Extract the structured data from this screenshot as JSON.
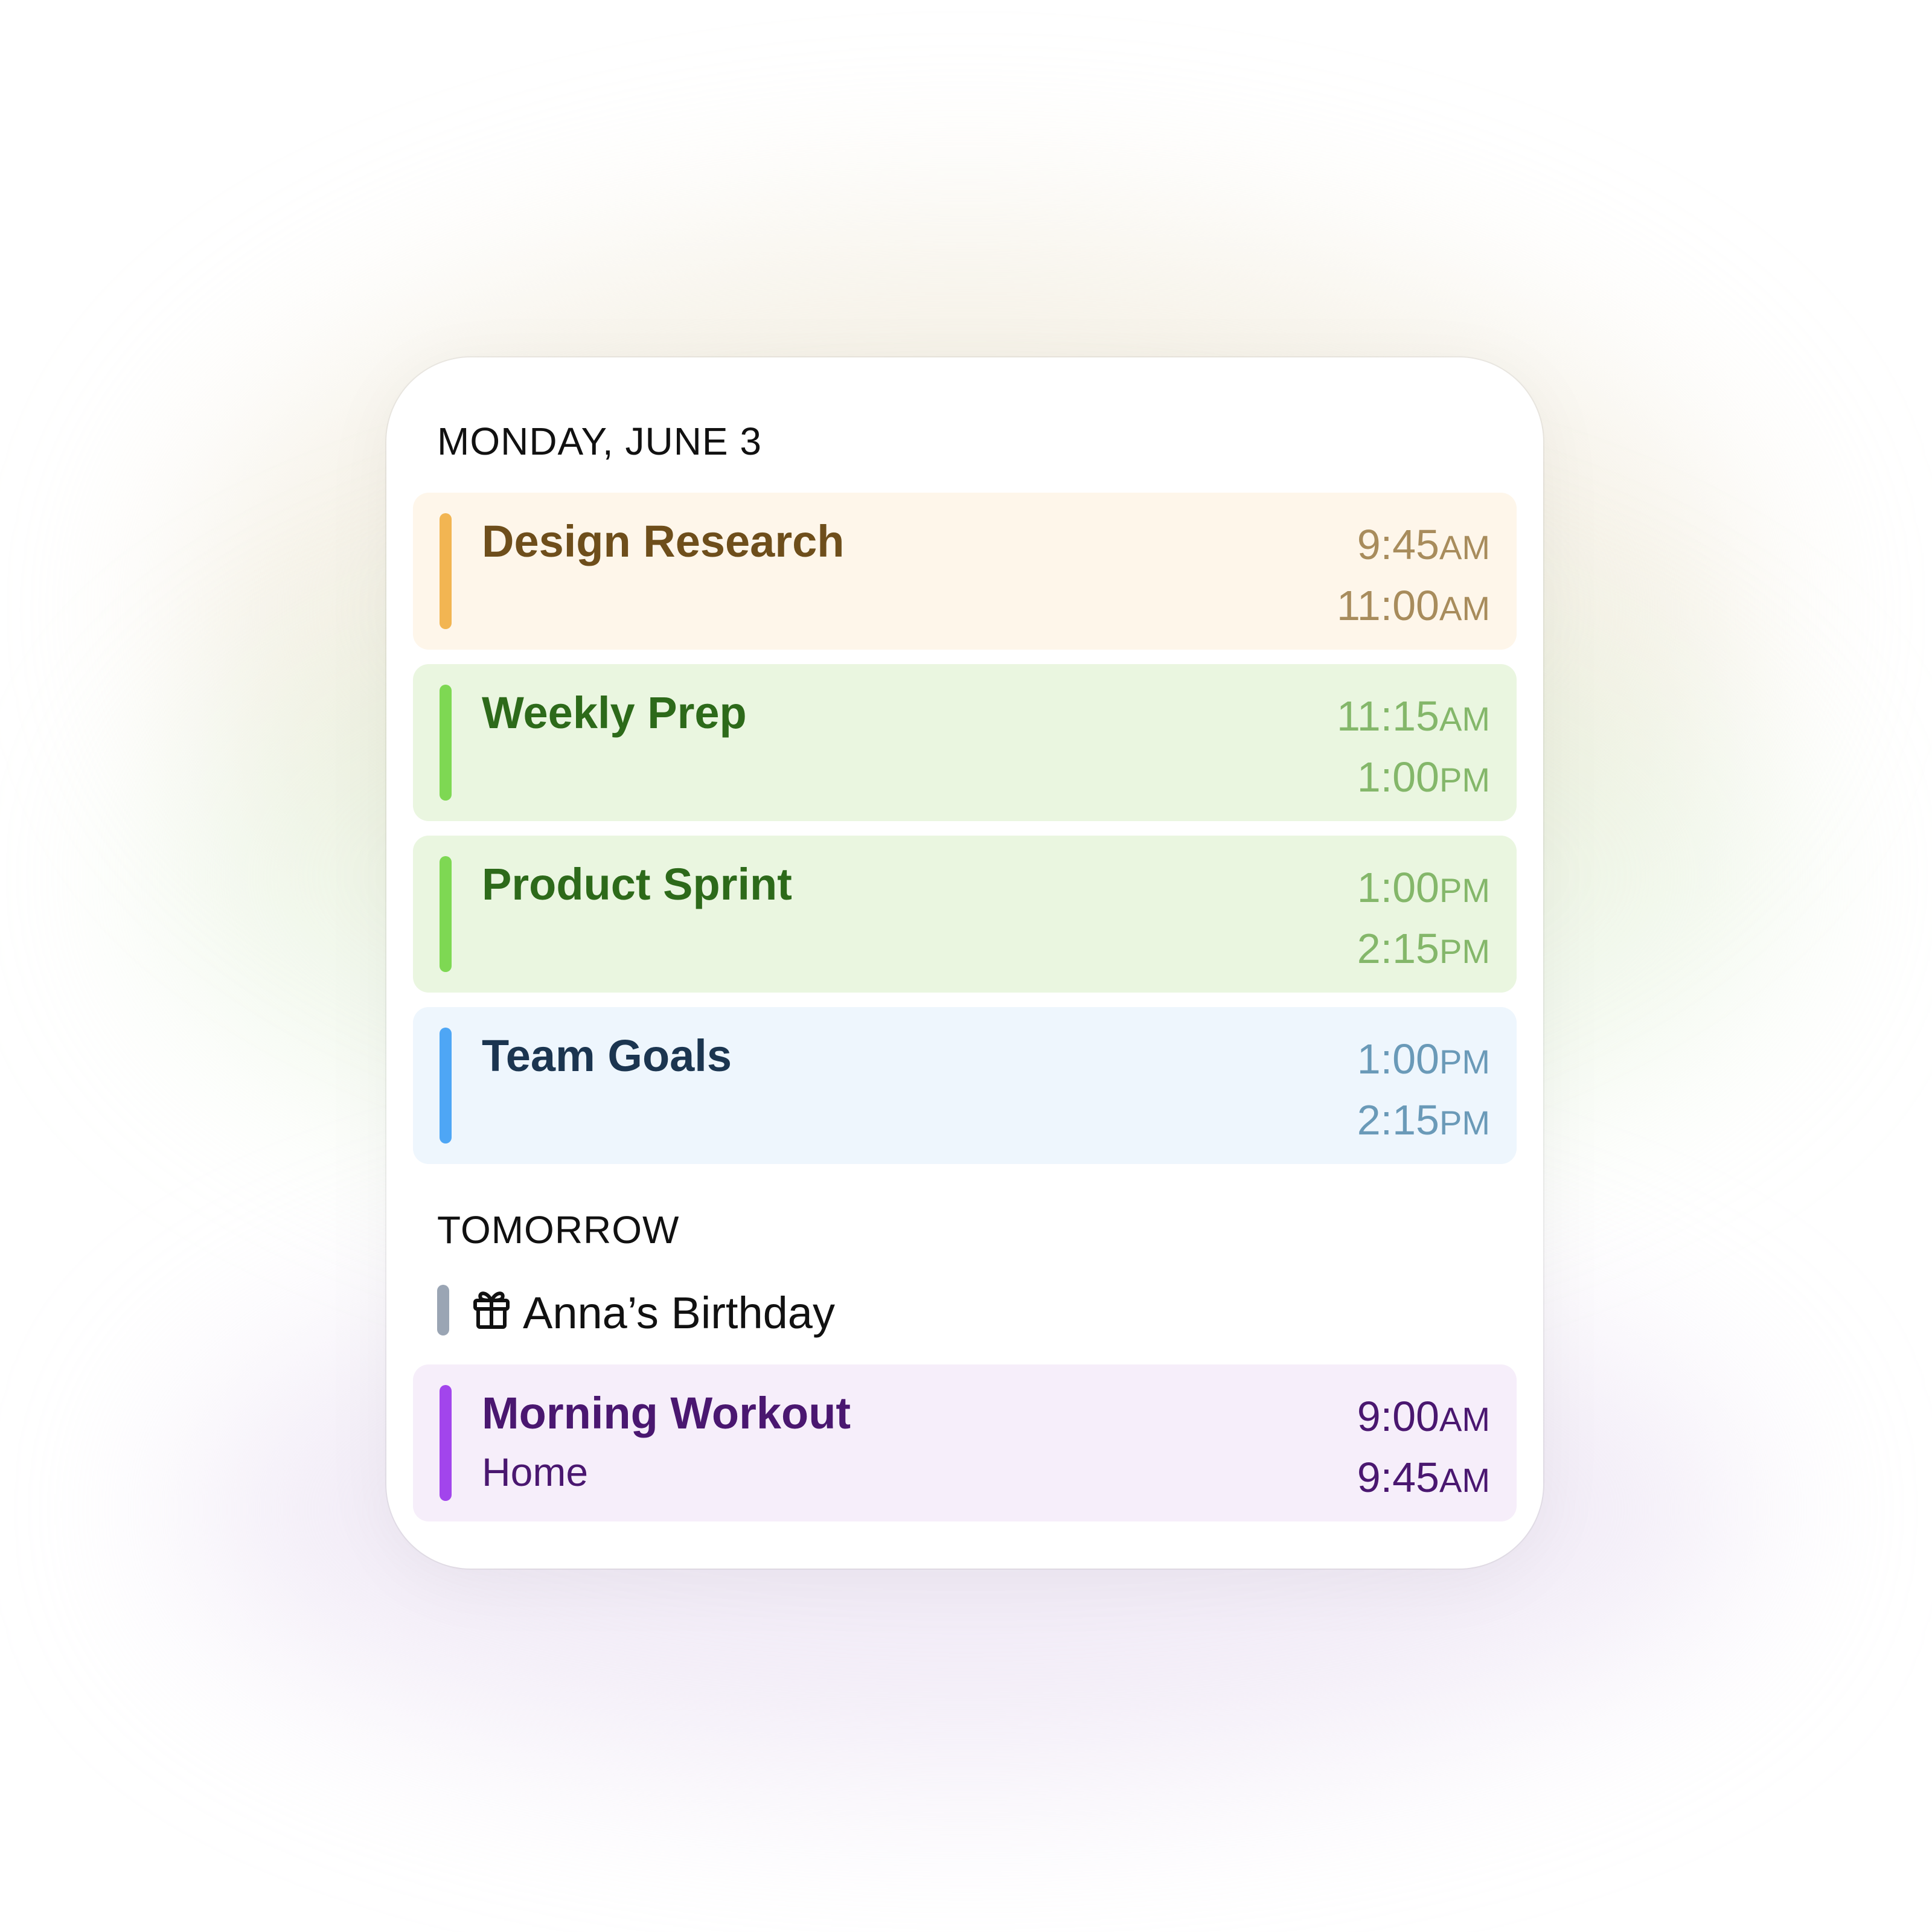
{
  "today": {
    "header": "MONDAY, JUNE 3",
    "events": [
      {
        "title": "Design Research",
        "start": "9:45",
        "start_period": "AM",
        "end": "11:00",
        "end_period": "AM",
        "colors": {
          "bg": "#FEF6EA",
          "bar": "#F2B552",
          "title": "#6E4E1B",
          "time": "#A88C5C"
        }
      },
      {
        "title": "Weekly Prep",
        "start": "11:15",
        "start_period": "AM",
        "end": "1:00",
        "end_period": "PM",
        "colors": {
          "bg": "#EAF6E0",
          "bar": "#7ED853",
          "title": "#2D6A1A",
          "time": "#84B76A"
        }
      },
      {
        "title": "Product Sprint",
        "start": "1:00",
        "start_period": "PM",
        "end": "2:15",
        "end_period": "PM",
        "colors": {
          "bg": "#EAF6E0",
          "bar": "#7ED853",
          "title": "#2D6A1A",
          "time": "#84B76A"
        }
      },
      {
        "title": "Team Goals",
        "start": "1:00",
        "start_period": "PM",
        "end": "2:15",
        "end_period": "PM",
        "colors": {
          "bg": "#EEF6FD",
          "bar": "#4EA6F5",
          "title": "#1B3550",
          "time": "#6A9AB8"
        }
      }
    ]
  },
  "tomorrow": {
    "header": "TOMORROW",
    "all_day": {
      "label": "Anna’s Birthday",
      "icon": "gift-icon",
      "bar_color": "#9AA5B4"
    },
    "events": [
      {
        "title": "Morning Workout",
        "location": "Home",
        "start": "9:00",
        "start_period": "AM",
        "end": "9:45",
        "end_period": "AM",
        "colors": {
          "bg": "#F6EEFA",
          "bar": "#A245EC",
          "title": "#4A1770",
          "time": "#4A1770"
        }
      }
    ]
  }
}
